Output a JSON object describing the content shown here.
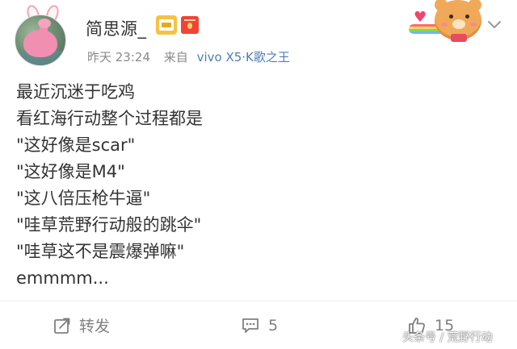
{
  "post": {
    "author": {
      "name": "简思源_"
    },
    "meta": {
      "time": "昨天 23:24",
      "source_prefix": "来自",
      "source_device": "vivo X5·K歌之王"
    },
    "lines": [
      "最近沉迷于吃鸡",
      "看红海行动整个过程都是",
      "\"这好像是scar\"",
      "\"这好像是M4\"",
      "\"这八倍压枪牛逼\"",
      "\"哇草荒野行动般的跳伞\"",
      "\"哇草这不是震爆弹嘛\"",
      "emmmm..."
    ]
  },
  "actions": {
    "repost_label": "转发",
    "comment_count": "5",
    "like_count": "15"
  },
  "watermark": "头条号 / 荒野行动",
  "colors": {
    "text": "#333333",
    "meta_gray": "#8a8a8a",
    "source_link": "#4f7db8",
    "action_gray": "#808080"
  },
  "icons": {
    "crown_badge": "crown-badge-icon",
    "red_packet": "red-packet-icon",
    "chevron": "chevron-down-icon",
    "repost": "repost-icon",
    "comment": "comment-icon",
    "like": "thumbs-up-icon"
  }
}
